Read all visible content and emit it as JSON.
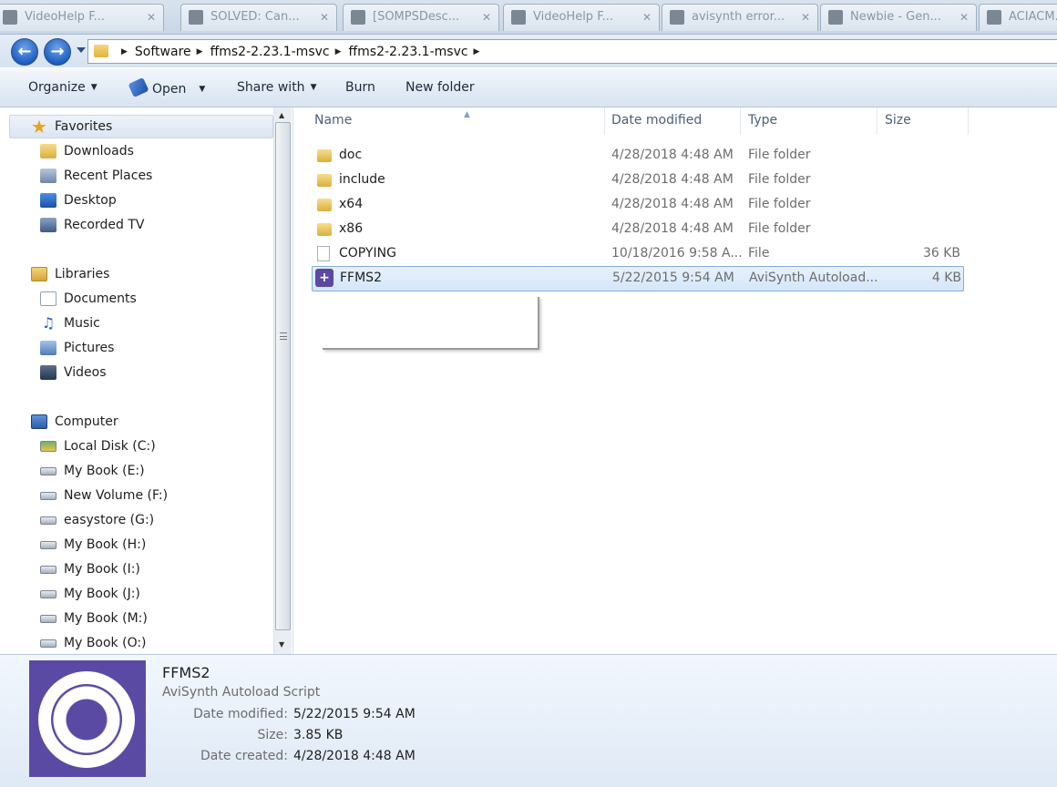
{
  "tabs": [
    {
      "label": "VideoHelp F...",
      "left": 0
    },
    {
      "label": "SOLVED: Can...",
      "left": 0
    },
    {
      "label": "[SOMPSDesc...",
      "left": 0
    },
    {
      "label": "VideoHelp F...",
      "left": 0
    },
    {
      "label": "avisynth error...",
      "left": 0
    },
    {
      "label": "Newbie - Gen...",
      "left": 0
    },
    {
      "label": "ACIACM...",
      "left": 0
    }
  ],
  "address": {
    "crumbs": [
      "Software",
      "ffms2-2.23.1-msvc",
      "ffms2-2.23.1-msvc"
    ]
  },
  "toolbar": {
    "organize": "Organize",
    "open": "Open",
    "share_with": "Share with",
    "burn": "Burn",
    "new_folder": "New folder"
  },
  "nav": {
    "favorites": "Favorites",
    "downloads": "Downloads",
    "recent_places": "Recent Places",
    "desktop": "Desktop",
    "recorded_tv": "Recorded TV",
    "libraries": "Libraries",
    "documents": "Documents",
    "music": "Music",
    "pictures": "Pictures",
    "videos": "Videos",
    "computer": "Computer",
    "drives": [
      "Local Disk (C:)",
      "My Book (E:)",
      "New Volume (F:)",
      "easystore (G:)",
      "My Book (H:)",
      "My Book (I:)",
      "My Book (J:)",
      "My Book (M:)",
      "My Book (O:)"
    ]
  },
  "columns": {
    "name": "Name",
    "date_modified": "Date modified",
    "type": "Type",
    "size": "Size"
  },
  "files": [
    {
      "name": "doc",
      "date": "4/28/2018 4:48 AM",
      "type": "File folder",
      "size": "",
      "icon": "folder-icon"
    },
    {
      "name": "include",
      "date": "4/28/2018 4:48 AM",
      "type": "File folder",
      "size": "",
      "icon": "folder-icon"
    },
    {
      "name": "x64",
      "date": "4/28/2018 4:48 AM",
      "type": "File folder",
      "size": "",
      "icon": "folder-icon"
    },
    {
      "name": "x86",
      "date": "4/28/2018 4:48 AM",
      "type": "File folder",
      "size": "",
      "icon": "folder-icon"
    },
    {
      "name": "COPYING",
      "date": "10/18/2016 9:58 A...",
      "type": "File",
      "size": "36 KB",
      "icon": "file-icon"
    },
    {
      "name": "FFMS2",
      "date": "5/22/2015 9:54 AM",
      "type": "AviSynth Autoload...",
      "size": "4 KB",
      "icon": "avisynth-script-icon"
    }
  ],
  "details": {
    "name": "FFMS2",
    "type": "AviSynth Autoload Script",
    "date_modified_label": "Date modified:",
    "date_modified": "5/22/2015 9:54 AM",
    "size_label": "Size:",
    "size": "3.85 KB",
    "date_created_label": "Date created:",
    "date_created": "4/28/2018 4:48 AM"
  },
  "colors": {
    "selection": "#d4e6fa",
    "avisynth_purple": "#5b4aa3"
  }
}
